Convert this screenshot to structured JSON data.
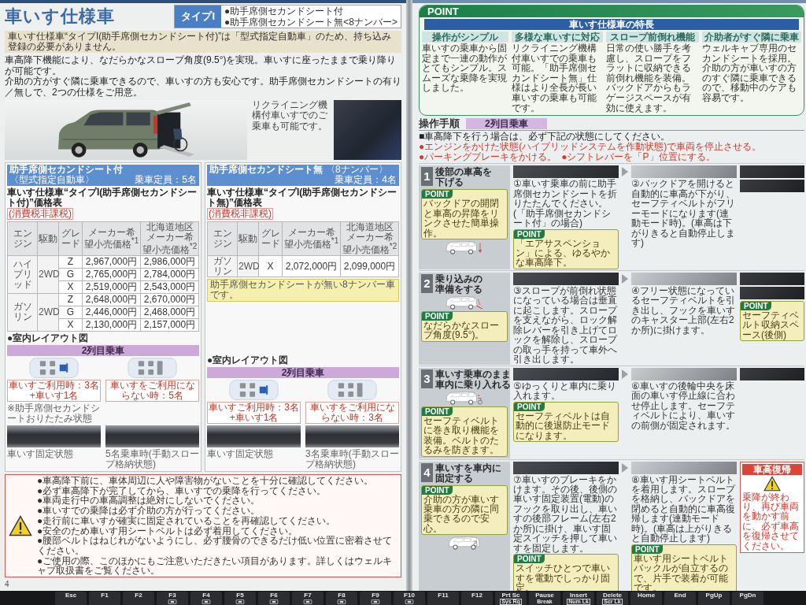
{
  "left_page": {
    "title": "車いす仕様車",
    "type_tag": {
      "label": "タイプI",
      "variants": [
        "●助手席側セカンドシート付",
        "●助手席側セカンドシート無<8ナンバー>"
      ]
    },
    "notice": "車いす仕様車“タイプI(助手席側セカンドシート付)”は「型式指定自動車」のため、持ち込み登録の必要がありません。",
    "lead": [
      "車高降下機能により、なだらかなスロープ角度(9.5°)を実現。車いすに座ったままで乗り降りが可能です。",
      "介助の方がすぐ隣に乗車できるので、車いすの方も安心です。助手席側セカンドシートの有り／無しで、2つの仕様をご用意。"
    ],
    "inset_caption": "リクライニング機構付車いすでのご乗車も可能です。",
    "price_cards": [
      {
        "header": "助手席側セカンドシート付",
        "header_note": "〈型式指定自動車〉",
        "capacity": "乗車定員：5名",
        "table_title": "車いす仕様車“タイプI(助手席側セカンドシート付)”価格表",
        "tax_note": "(消費税非課税)",
        "columns": [
          "エンジン",
          "駆動",
          "グレード",
          "メーカー希望小売価格$^{*1}$",
          "北海道地区メーカー希望小売価格$^{*2}$"
        ],
        "groups": [
          {
            "engine": "ハイブリッド",
            "drive": "2WD",
            "grades": [
              {
                "grade": "Z",
                "price": "2,967,000円",
                "hokkaido_price": "2,986,000円"
              },
              {
                "grade": "G",
                "price": "2,765,000円",
                "hokkaido_price": "2,784,000円"
              },
              {
                "grade": "X",
                "price": "2,519,000円",
                "hokkaido_price": "2,543,000円"
              }
            ]
          },
          {
            "engine": "ガソリン",
            "drive": "2WD",
            "grades": [
              {
                "grade": "Z",
                "price": "2,648,000円",
                "hokkaido_price": "2,670,000円"
              },
              {
                "grade": "G",
                "price": "2,446,000円",
                "hokkaido_price": "2,468,000円"
              },
              {
                "grade": "X",
                "price": "2,130,000円",
                "hokkaido_price": "2,157,000円"
              }
            ]
          }
        ],
        "layout_heading": "●室内レイアウト図",
        "layout_bar": "2列目乗車",
        "views": [
          {
            "wheelchair": true,
            "caption": "車いすご利用時：3名+車いす1名",
            "note": "※助手席側セカンドシートおりたたみ状態",
            "photo_caption": "車いす固定状態"
          },
          {
            "wheelchair": false,
            "caption": "車いすをご利用にならない時：5名",
            "photo_caption": "5名乗車時(手動スロープ格納状態)"
          }
        ]
      },
      {
        "header": "助手席側セカンドシート無",
        "header_note": "〈8ナンバー〉",
        "capacity": "乗車定員：4名",
        "table_title": "車いす仕様車“タイプI(助手席側セカンドシート無)”価格表",
        "tax_note": "(消費税非課税)",
        "columns": [
          "エンジン",
          "駆動",
          "グレード",
          "メーカー希望小売価格$^{*1}$",
          "北海道地区メーカー希望小売価格$^{*2}$"
        ],
        "groups": [
          {
            "engine": "ガソリン",
            "drive": "2WD",
            "grades": [
              {
                "grade": "X",
                "price": "2,072,000円",
                "hokkaido_price": "2,099,000円"
              }
            ]
          }
        ],
        "note": "助手席側セカンドシートが無い8ナンバー車です。",
        "layout_heading": "●室内レイアウト図",
        "layout_bar": "2列目乗車",
        "views": [
          {
            "wheelchair": true,
            "caption": "車いすご利用時：3名+車いす1名",
            "photo_caption": "車いす固定状態"
          },
          {
            "wheelchair": false,
            "caption": "車いすをご利用にならない時：3名",
            "photo_caption": "3名乗車時(手動スロープ格納状態)"
          }
        ]
      }
    ],
    "warnings": [
      "●車高降下前に、車体周辺に人や障害物がないことを十分に確認してください。",
      "●必ず車高降下が完了してから、車いすでの乗降を行ってください。",
      "●車両走行中の車高調整は絶対にしないでください。",
      "●車いすでの乗降は必ず介助の方が行ってください。",
      "●走行前に車いすが確実に固定されていることを再確認してください。",
      "●安全のため車いす用シートベルトは必ず着用してください。",
      "●腰部ベルトはねじれがないようにし、必ず腰骨のできるだけ低い位置に密着させてください。",
      "●ご使用の際、このほかにもご注意いただきたい項目があります。詳しくはウェルキャブ取扱書をご覧ください。"
    ],
    "page_number": "4"
  },
  "right_page": {
    "point_panel": {
      "label": "POINT",
      "heading": "車いす仕様車の特長",
      "features": [
        {
          "title": "操作がシンプル",
          "text": "車いすの乗車から固定まで一連の動作がとてもシンプル。スムーズな乗降を実現しました。"
        },
        {
          "title": "多様な車いすに対応",
          "text": "リクライニング機構付車いすでの乗車も可能。「助手席側セカンドシート無」仕様はより全長が長い車いすの乗車も可能です。"
        },
        {
          "title": "スロープ前倒れ機能",
          "text": "日常の使い勝手を考慮し、スロープをフラットに収納できる前倒れ機能を装備。バックドアからもラゲージスペースが有効に使えます。"
        },
        {
          "title": "介助者がすぐ隣に乗車",
          "text": "ウェルキャブ専用のセカンドシートを採用。介助の方が車いすの方のすぐ隣に乗車できるので、移動中のケアも容易です。"
        }
      ]
    },
    "procedure": {
      "heading": "操作手順",
      "mode": "2列目乗車",
      "intro": "■車高降下を行う場合は、必ず下記の状態にしてください。",
      "conditions": [
        "●エンジンをかけた状態(ハイブリッドシステムを作動状態)で車両を停止させる。",
        "●パーキングブレーキをかける。",
        "●シフトレバーを「P」位置にする。"
      ]
    },
    "steps": [
      {
        "number": "1",
        "title": [
          "後部の車高を",
          "下げる"
        ],
        "panel": [
          {
            "kind": "point",
            "label": "POINT",
            "text": "バックドアの開閉と車高の昇降をリンクさせた簡単操作。"
          },
          {
            "kind": "lowering"
          }
        ],
        "photos": [
          {
            "caption": "①車いす乗車の前に助手席側セカンドシートを折りたたんでください。(「助手席側セカンドシート付」の場合)",
            "points": [
              {
                "label": "POINT",
                "text": "「エアサスペンション」による、ゆるやかな車高降下。"
              }
            ]
          },
          {
            "caption": "②バックドアを開けると自動的に車高が下がり、セーフティベルトがフリーモードになります(連動モード時)。(車高は下がりきると自動停止します)"
          }
        ],
        "side": [
          {
            "kind": "photo"
          },
          {
            "kind": "photo"
          }
        ]
      },
      {
        "number": "2",
        "title": [
          "乗り込みの",
          "準備をする"
        ],
        "panel": [
          {
            "kind": "ramp"
          },
          {
            "kind": "point",
            "label": "POINT",
            "text": "なだらかなスロープ角度(9.5°)。"
          }
        ],
        "photos": [
          {
            "caption": "③スロープが前倒れ状態になっている場合は垂直に起こします。スロープを支えながら、ロック解除レバーを引き上げてロックを解除し、スロープの取っ手を持って車外へ引き出します。"
          },
          {
            "caption": "④フリー状態になっているセーフティベルトを引き出し、フックを車いすのキャスター上部(左右2か所)に掛けます。"
          }
        ],
        "side": [
          {
            "kind": "photo"
          },
          {
            "kind": "photo"
          },
          {
            "kind": "point",
            "label": "POINT",
            "text": "セーフティベルト収納スペース(後側)"
          }
        ]
      },
      {
        "number": "3",
        "title": [
          "車いす乗車のまま",
          "車内に乗り入れる"
        ],
        "panel": [
          {
            "kind": "boarding"
          },
          {
            "kind": "point",
            "label": "POINT",
            "text": "セーフティベルトに巻き取り機能を装備。ベルトのたるみを防ぎます。"
          }
        ],
        "photos": [
          {
            "caption": "⑤ゆっくりと車内に乗り入れます。",
            "points": [
              {
                "label": "POINT",
                "text": "セーフティベルトは自動的に後退防止モードになります。"
              }
            ]
          },
          {
            "caption": "⑥車いすの後輪中央を床面の車いす停止線に合わせ停止します。セーフティベルトにより、車いすの前側が固定されます。"
          }
        ],
        "side": [
          {
            "kind": "photo"
          }
        ]
      },
      {
        "number": "4",
        "title": [
          "車いすを車内に",
          "固定する"
        ],
        "panel": [
          {
            "kind": "point",
            "label": "POINT",
            "text": "介助の方が車いす乗車の方の隣に同乗できるので安心。"
          },
          {
            "kind": "secured"
          }
        ],
        "photos": [
          {
            "caption": "⑦車いすのブレーキをかけます。その後、後側の車いす固定装置(電動)のフックを取り出し、車いすの後部フレーム(左右2か所)に掛け、車いす固定スイッチを押して車いすを固定します。",
            "points": [
              {
                "label": "POINT",
                "text": "スイッチひとつで車いすを電動でしっかり固定。"
              }
            ]
          },
          {
            "caption": "⑧車いす用シートベルトを着用します。スロープを格納し、バックドアを閉めると自動的に車高復帰します(連動モード時)。(車高は上がりきると自動停止します)",
            "points": [
              {
                "label": "POINT",
                "text": "車いす用シートベルトバックルが自立するので、片手で装着が可能です。"
              }
            ]
          }
        ],
        "side": [
          {
            "kind": "warning",
            "title": "車高復帰",
            "text": "乗降が終わり、再び車両を動かす前に、必ず車高を復帰させてください。"
          }
        ]
      }
    ]
  },
  "keyboard": {
    "keys": [
      {
        "kind": "plain",
        "label": "Esc"
      },
      {
        "kind": "plain",
        "label": "F1"
      },
      {
        "kind": "plain",
        "label": "F2"
      },
      {
        "kind": "symbol",
        "label": "F3"
      },
      {
        "kind": "symbol",
        "label": "F4"
      },
      {
        "kind": "symbol",
        "label": "F5"
      },
      {
        "kind": "symbol",
        "label": "F6"
      },
      {
        "kind": "symbol",
        "label": "F7"
      },
      {
        "kind": "symbol",
        "label": "F8"
      },
      {
        "kind": "symbol",
        "label": "F9"
      },
      {
        "kind": "symbol",
        "label": "F10"
      },
      {
        "kind": "plain",
        "label": "F11"
      },
      {
        "kind": "plain",
        "label": "F12"
      },
      {
        "kind": "dual",
        "label": "Prt Sc",
        "sub": "Sys Rq"
      },
      {
        "kind": "stacked",
        "label": "Pause",
        "sub": "Break"
      },
      {
        "kind": "dual",
        "label": "Insert",
        "sub": "Num Lk"
      },
      {
        "kind": "dual",
        "label": "Delete",
        "sub": "Scr Lk"
      },
      {
        "kind": "plain",
        "label": "Home"
      },
      {
        "kind": "plain",
        "label": "End"
      },
      {
        "kind": "plain",
        "label": "PgUp"
      },
      {
        "kind": "plain",
        "label": "PgDn"
      }
    ]
  }
}
